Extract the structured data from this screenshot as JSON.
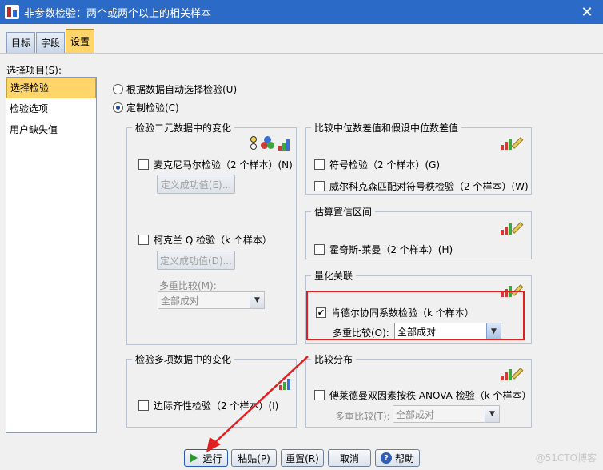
{
  "window": {
    "title": "非参数检验：两个或两个以上的相关样本",
    "close_label": "✕"
  },
  "tabs": [
    {
      "label": "目标"
    },
    {
      "label": "字段"
    },
    {
      "label": "设置"
    }
  ],
  "selection": {
    "label": "选择项目(S):",
    "items": [
      {
        "label": "选择检验"
      },
      {
        "label": "检验选项"
      },
      {
        "label": "用户缺失值"
      }
    ]
  },
  "mode": {
    "auto_label": "根据数据自动选择检验(U)",
    "custom_label": "定制检验(C)"
  },
  "binary_group": {
    "title": "检验二元数据中的变化",
    "mcnemar_label": "麦克尼马尔检验（2 个样本）(N)",
    "mcnemar_success_button": "定义成功值(E)...",
    "cochran_label": "柯克兰 Q 检验（k 个样本）",
    "cochran_success_button": "定义成功值(D)...",
    "multi_label": "多重比较(M):",
    "multi_value": "全部成对"
  },
  "median_group": {
    "title": "比较中位数差值和假设中位数差值",
    "sign_label": "符号检验（2 个样本）(G)",
    "wilcoxon_label": "威尔科克森匹配对符号秩检验（2 个样本）(W)"
  },
  "ci_group": {
    "title": "估算置信区间",
    "hodges_label": "霍奇斯-莱曼（2 个样本）(H)"
  },
  "assoc_group": {
    "title": "量化关联",
    "kendall_label": "肯德尔协同系数检验（k 个样本）",
    "kendall_checked": true,
    "multi_label": "多重比较(O):",
    "multi_value": "全部成对"
  },
  "multinomial_group": {
    "title": "检验多项数据中的变化",
    "marginal_label": "边际齐性检验（2 个样本）(I)"
  },
  "distribution_group": {
    "title": "比较分布",
    "friedman_label": "傅莱德曼双因素按秩 ANOVA 检验（k 个样本）",
    "multi_label": "多重比较(T):",
    "multi_value": "全部成对"
  },
  "buttons": {
    "run": "运行",
    "paste": "粘贴(P)",
    "reset": "重置(R)",
    "cancel": "取消",
    "help": "帮助"
  },
  "watermark": "@51CTO博客",
  "colors": {
    "titlebar": "#2b6bc7",
    "selected": "#ffd56a",
    "highlight_box": "#e02020"
  }
}
